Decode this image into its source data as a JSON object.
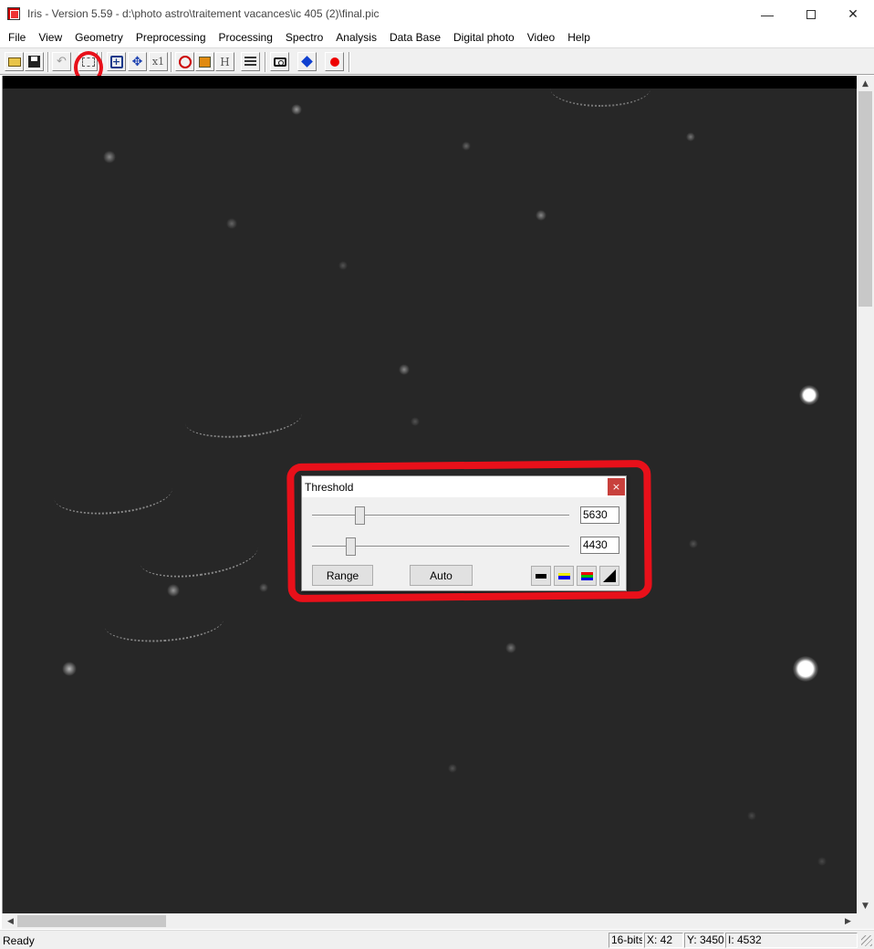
{
  "window": {
    "title": "Iris - Version 5.59 - d:\\photo astro\\traitement vacances\\ic 405 (2)\\final.pic",
    "minimize_glyph": "—",
    "maximize_glyph": "",
    "close_glyph": "✕"
  },
  "menu": [
    "File",
    "View",
    "Geometry",
    "Preprocessing",
    "Processing",
    "Spectro",
    "Analysis",
    "Data Base",
    "Digital photo",
    "Video",
    "Help"
  ],
  "toolbar": {
    "buttons": [
      {
        "icon": "open-folder-icon"
      },
      {
        "icon": "save-icon"
      },
      {
        "icon": "undo-icon",
        "glyph": "↶"
      },
      {
        "icon": "crop-icon"
      },
      {
        "icon": "zoom-fit-icon",
        "glyph": "+"
      },
      {
        "icon": "move-icon",
        "glyph": "✥"
      },
      {
        "icon": "zoom-x1-icon",
        "glyph": "x1"
      },
      {
        "icon": "rotate-icon"
      },
      {
        "icon": "color-icon"
      },
      {
        "icon": "histogram-icon",
        "glyph": "H"
      },
      {
        "icon": "list-icon"
      },
      {
        "icon": "camera-icon"
      },
      {
        "icon": "blue-diamond-icon"
      },
      {
        "icon": "red-record-icon"
      }
    ]
  },
  "dialog": {
    "title": "Threshold",
    "close_glyph": "×",
    "high_value": "5630",
    "low_value": "4430",
    "range_label": "Range",
    "auto_label": "Auto"
  },
  "scroll": {
    "up_glyph": "▲",
    "down_glyph": "▼",
    "left_glyph": "◀",
    "right_glyph": "▶"
  },
  "status": {
    "text": "Ready",
    "depth": "16-bits",
    "x": "X: 42",
    "y": "Y: 3450",
    "intensity": "I: 4532"
  },
  "colors": {
    "sky": "#272727",
    "annotation": "#e8101a",
    "dialog_close": "#c8403c"
  }
}
